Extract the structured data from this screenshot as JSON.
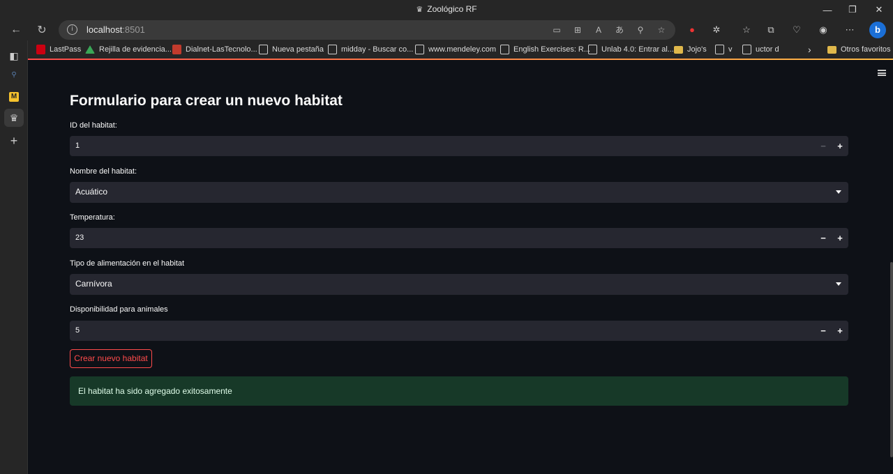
{
  "window": {
    "title": "Zoológico RF"
  },
  "browser": {
    "url_host": "localhost",
    "url_port": ":8501",
    "bookmarks": [
      "LastPass",
      "Rejilla de evidencia...",
      "Dialnet-LasTecnolo...",
      "Nueva pestaña",
      "midday - Buscar co...",
      "www.mendeley.com",
      "English Exercises: R...",
      "Unlab 4.0: Entrar al...",
      "Jojo's",
      "v",
      "uctor d",
      "Otros favoritos"
    ]
  },
  "form": {
    "title": "Formulario para crear un nuevo habitat",
    "id_label": "ID del habitat:",
    "id_value": "1",
    "name_label": "Nombre del habitat:",
    "name_value": "Acuático",
    "temp_label": "Temperatura:",
    "temp_value": "23",
    "food_label": "Tipo de alimentación en el habitat",
    "food_value": "Carnívora",
    "avail_label": "Disponibilidad para animales",
    "avail_value": "5",
    "submit_label": "Crear nuevo habitat",
    "success_message": "El habitat ha sido agregado exitosamente"
  },
  "steppers": {
    "minus": "−",
    "plus": "+"
  },
  "colors": {
    "accent": "#ff4b4b",
    "success_bg": "#173928",
    "field_bg": "#262730",
    "page_bg": "#0e1117"
  }
}
